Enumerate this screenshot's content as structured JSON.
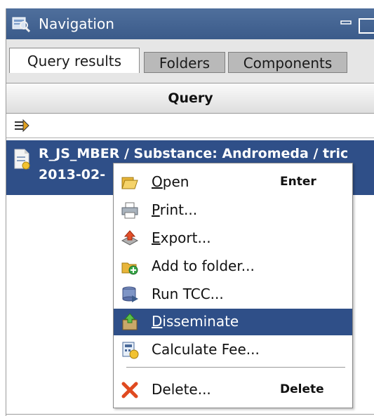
{
  "panel": {
    "title": "Navigation",
    "tabs": [
      {
        "label": "Query results",
        "active": true
      },
      {
        "label": "Folders",
        "active": false
      },
      {
        "label": "Components",
        "active": false
      }
    ],
    "column_header": "Query",
    "filter_icon": "filter-icon",
    "selected_row": {
      "line1": "R_JS_MBER / Substance: Andromeda / tric",
      "line2": "2013-02-"
    }
  },
  "context_menu": {
    "items": [
      {
        "pre": "",
        "acc": "O",
        "post": "pen",
        "shortcut": "Enter",
        "icon": "open-folder-icon"
      },
      {
        "pre": "",
        "acc": "P",
        "post": "rint...",
        "shortcut": "",
        "icon": "print-icon"
      },
      {
        "pre": "",
        "acc": "E",
        "post": "xport...",
        "shortcut": "",
        "icon": "export-icon"
      },
      {
        "pre": "Add to folder...",
        "acc": "",
        "post": "",
        "shortcut": "",
        "icon": "add-to-folder-icon"
      },
      {
        "pre": "Run TCC...",
        "acc": "",
        "post": "",
        "shortcut": "",
        "icon": "run-tcc-icon"
      },
      {
        "pre": "",
        "acc": "D",
        "post": "isseminate",
        "shortcut": "",
        "icon": "disseminate-icon",
        "highlighted": true
      },
      {
        "pre": "Calculate Fee...",
        "acc": "",
        "post": "",
        "shortcut": "",
        "icon": "calculate-fee-icon"
      },
      {
        "pre": "Delete...",
        "acc": "",
        "post": "",
        "shortcut": "Delete",
        "icon": "delete-icon"
      }
    ]
  },
  "colors": {
    "selection": "#2f4f88",
    "titlebar": "#3b5b8a",
    "inactive_tab": "#b9b9b9"
  }
}
